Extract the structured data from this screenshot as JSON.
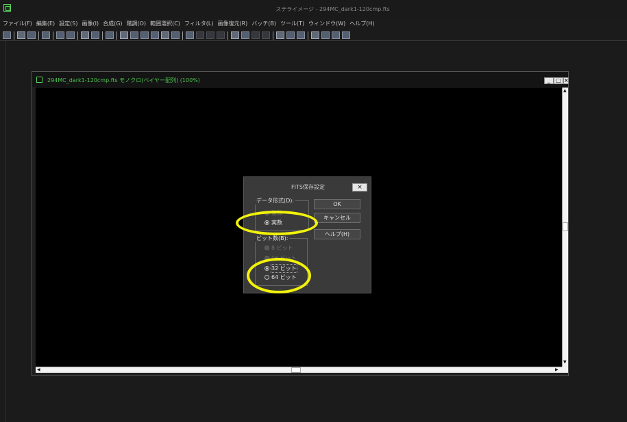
{
  "titlebar": {
    "title": "ステライメージ - 294MC_dark1-120cmp.fts"
  },
  "menu": [
    "ファイル(F)",
    "編集(E)",
    "設定(S)",
    "画像(I)",
    "合成(G)",
    "階調(O)",
    "範囲選択(C)",
    "フィルタ(L)",
    "画像復元(R)",
    "バッチ(B)",
    "ツール(T)",
    "ウィンドウ(W)",
    "ヘルプ(H)"
  ],
  "toolbar": {
    "icons": [
      "open-icon",
      "sep",
      "save-icon",
      "save-as-icon",
      "sep",
      "batch-icon",
      "sep",
      "image-list-icon",
      "grid-icon",
      "sep",
      "compare-icon",
      "frame-icon",
      "sep",
      "info-icon",
      "sep",
      "mountain-icon",
      "composite-icon",
      "align-icon",
      "stack-icon",
      "flat-icon",
      "square-icon",
      "sep",
      "histogram-icon",
      "dots-icon",
      "levels-icon",
      "star-icon",
      "sep",
      "filter-icon",
      "curves-icon",
      "deconv-icon",
      "circle-icon",
      "sep",
      "zoom-in-icon",
      "zoom-out-icon",
      "palette-icon",
      "sep",
      "chart-icon",
      "network-icon",
      "monitor-icon",
      "sparkle-icon"
    ]
  },
  "image_window": {
    "title": "294MC_dark1-120cmp.fts モノクロ(ベイヤー配列) (100%)",
    "minimize": "_",
    "maximize": "□",
    "close": "×"
  },
  "dialog": {
    "title": "FITS保存設定",
    "close": "×",
    "data_format_label": "データ形式(D):",
    "data_format_options": [
      "整数",
      "実数"
    ],
    "data_format_selected": "実数",
    "bits_label": "ビット数(B):",
    "bits_options": [
      "8 ビット",
      "16 ビット",
      "32 ビット",
      "64 ビット"
    ],
    "bits_selected": "32 ビット",
    "ok": "OK",
    "cancel": "キャンセル",
    "help": "ヘルプ(H)"
  },
  "colors": {
    "highlight": "#f2f20a",
    "window_title_text": "#4fc34f",
    "background": "#1b1b1b"
  }
}
